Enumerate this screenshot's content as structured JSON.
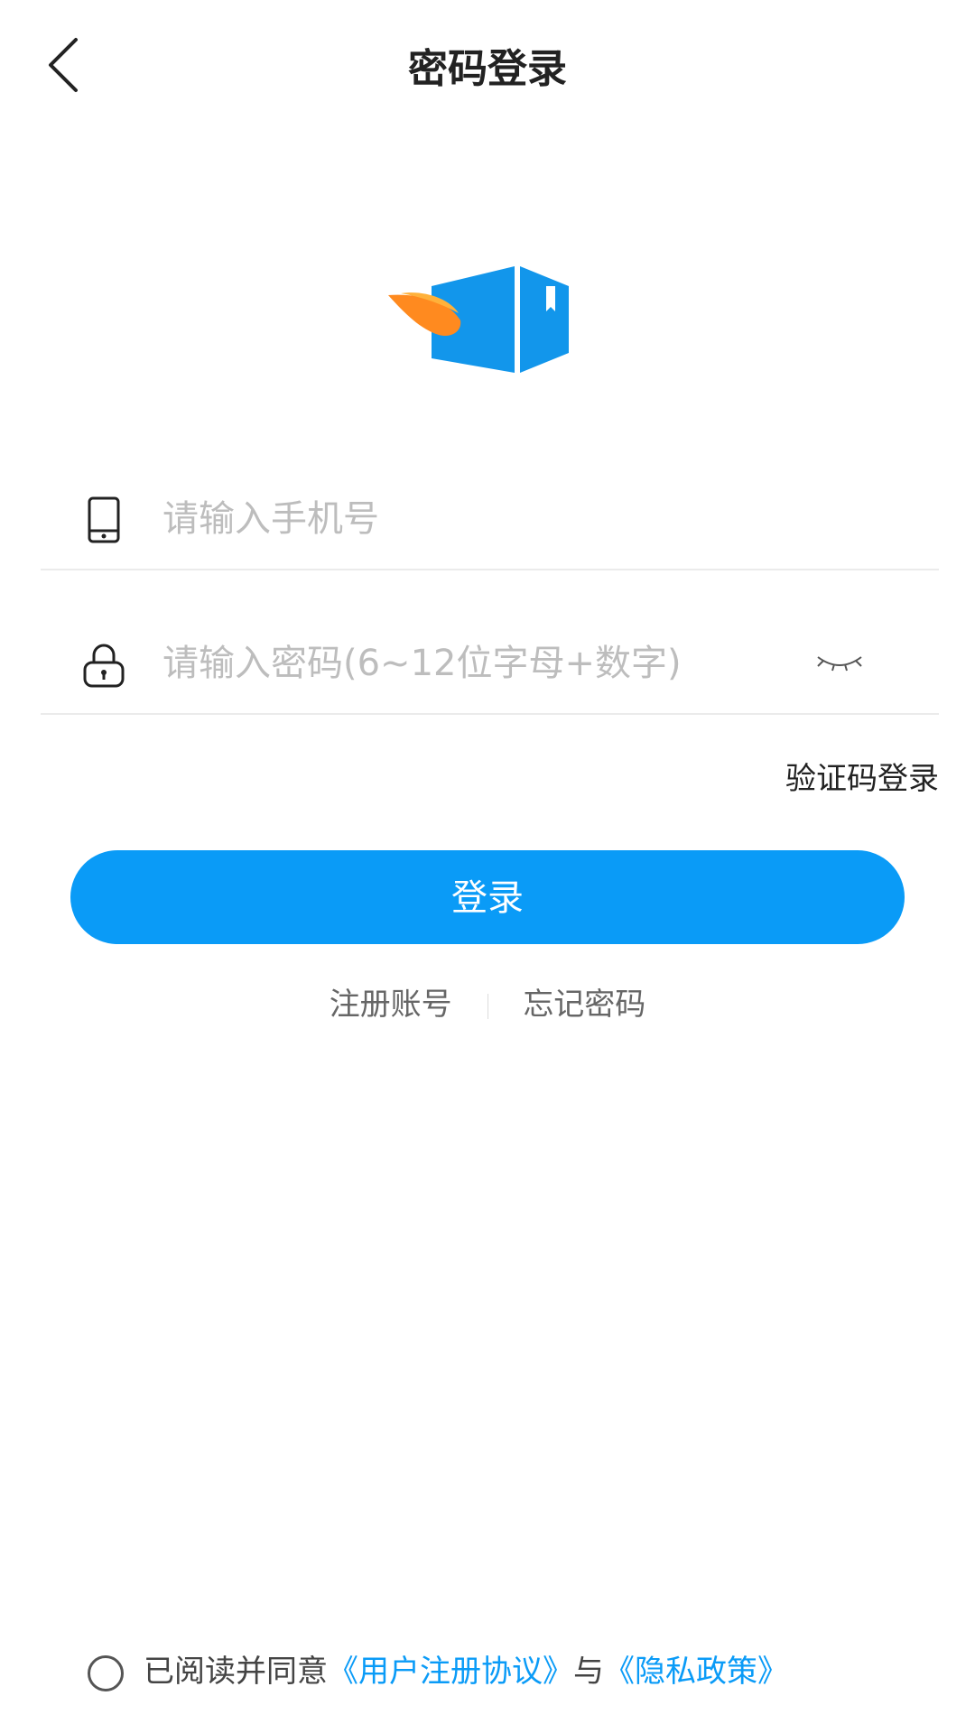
{
  "header": {
    "title": "密码登录",
    "back_icon": "chevron-left-icon"
  },
  "logo": {
    "icon": "box-with-wing-logo",
    "colors": {
      "box": "#1296eb",
      "wing": "#ff8a1f",
      "wing_light": "#ffb13a"
    }
  },
  "form": {
    "phone_placeholder": "请输入手机号",
    "phone_icon": "phone-icon",
    "password_placeholder": "请输入密码(6~12位字母+数字)",
    "password_icon": "lock-icon",
    "eye_icon": "eye-closed-icon"
  },
  "sms_login_label": "验证码登录",
  "login_button_label": "登录",
  "links": {
    "register": "注册账号",
    "forgot": "忘记密码"
  },
  "agreement": {
    "prefix": "已阅读并同意",
    "user_agreement": "《用户注册协议》",
    "and": "与",
    "privacy_policy": "《隐私政策》"
  },
  "colors": {
    "accent": "#0a9bf7",
    "placeholder": "#bdbdbd",
    "divider": "#ebebeb"
  }
}
